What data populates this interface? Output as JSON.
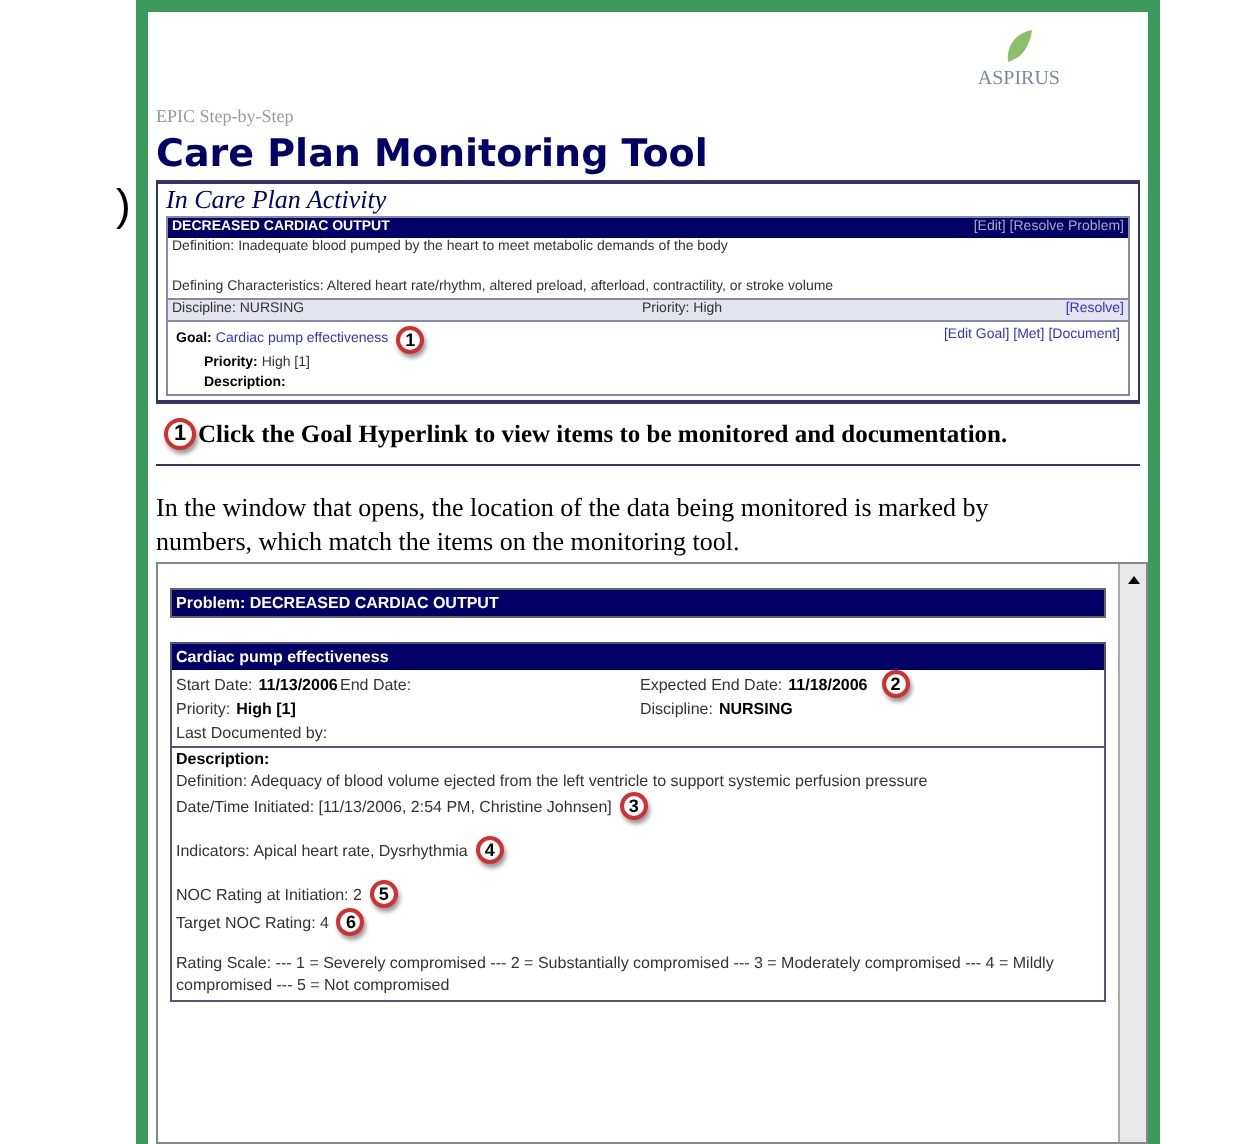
{
  "edge_text": ")",
  "header": {
    "subtitle": "EPIC Step-by-Step",
    "title": "Care Plan Monitoring Tool",
    "logo_text": "ASPIRUS"
  },
  "activity": {
    "heading": "In Care Plan Activity",
    "problem": "DECREASED CARDIAC OUTPUT",
    "problem_actions": [
      "[Edit]",
      "[Resolve Problem]"
    ],
    "definition": "Definition: Inadequate blood pumped by the heart to meet metabolic demands of the body",
    "characteristics": "Defining Characteristics: Altered heart rate/rhythm, altered preload, afterload, contractility, or stroke volume",
    "discipline": "Discipline: NURSING",
    "priority": "Priority: High",
    "resolve": "[Resolve]",
    "goal_label": "Goal:",
    "goal_link": "Cardiac pump effectiveness",
    "goal_marker": "1",
    "goal_actions": [
      "[Edit Goal]",
      "[Met]",
      "[Document]"
    ],
    "priority_label": "Priority:",
    "priority_value": "High [1]",
    "description_label": "Description:"
  },
  "instruction": {
    "marker": "1",
    "text": "Click the Goal Hyperlink to view items to be monitored and documentation."
  },
  "intro": "In the window that opens, the location of the data being monitored is marked by numbers, which match the items on the monitoring tool.",
  "window": {
    "problem_header": "Problem: DECREASED CARDIAC OUTPUT",
    "goal_header": "Cardiac pump effectiveness",
    "field_columns": [
      [
        {
          "label": "Start Date:",
          "value": "11/13/2006"
        },
        {
          "label": "Priority:",
          "value": "High [1]"
        },
        {
          "label": "Last Documented by:"
        }
      ],
      [
        {
          "label": "End Date:"
        }
      ],
      [
        {
          "label": "Expected End Date:",
          "value": "11/18/2006",
          "marker": "2"
        },
        {
          "label": "Discipline:",
          "value": "NURSING"
        }
      ]
    ],
    "description_label": "Description:",
    "paragraphs": [
      [
        {
          "text": "Definition: Adequacy of blood volume ejected from the left ventricle to support systemic perfusion pressure"
        },
        {
          "text": "Date/Time Initiated: [11/13/2006, 2:54 PM, Christine Johnsen]",
          "marker": "3"
        }
      ],
      [
        {
          "text": "Indicators:  Apical heart rate, Dysrhythmia",
          "marker": "4"
        }
      ],
      [
        {
          "text": "NOC Rating at Initiation: 2",
          "marker": "5"
        },
        {
          "text": "Target NOC Rating: 4",
          "marker": "6"
        }
      ],
      [
        {
          "text": "Rating Scale: --- 1 = Severely compromised --- 2 = Substantially compromised --- 3 = Moderately compromised --- 4 = Mildly compromised --- 5 = Not compromised"
        }
      ]
    ]
  }
}
